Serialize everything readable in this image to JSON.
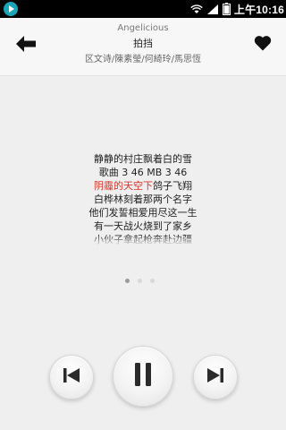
{
  "status_bar": {
    "time": "上午10:16"
  },
  "header": {
    "artist": "Angelicious",
    "title": "拍挡",
    "credits": "区文诗/陳素瑩/何綺玲/馬思恆"
  },
  "lyrics": [
    {
      "pre": "静静的村庄飘着白的雪",
      "hl": "",
      "post": ""
    },
    {
      "pre": "歌曲 3 46 MB 3 46",
      "hl": "",
      "post": ""
    },
    {
      "pre": "",
      "hl": "阴霾的天空下",
      "post": "鸽子飞翔"
    },
    {
      "pre": "白桦林刻着那两个名字",
      "hl": "",
      "post": ""
    },
    {
      "pre": "他们发誓相爱用尽这一生",
      "hl": "",
      "post": ""
    },
    {
      "pre": "有一天战火烧到了家乡",
      "hl": "",
      "post": ""
    },
    {
      "pre": "小伙子拿起枪奔赴边疆",
      "hl": "",
      "post": ""
    }
  ],
  "active_lyric_index": 2,
  "pager": {
    "count": 3,
    "active": 0
  },
  "controls": {
    "state": "playing"
  },
  "colors": {
    "highlight": "#e0342c",
    "status_icon": "#17a6b8"
  }
}
